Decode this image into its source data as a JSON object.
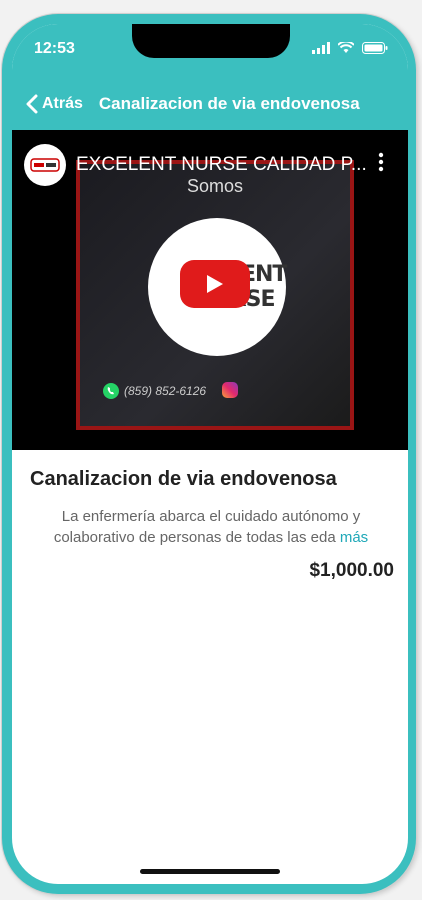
{
  "status_bar": {
    "time": "12:53"
  },
  "nav": {
    "back_label": "Atrás",
    "title": "Canalizacion de via endovenosa"
  },
  "video": {
    "channel_title": "EXCELENT NURSE CALIDAD P...",
    "subtitle": "Somos",
    "logo_line1": "XCELENT",
    "logo_line2": "NURSE",
    "phone": "(859) 852-6126"
  },
  "product": {
    "title": "Canalizacion de via endovenosa",
    "description": "La enfermería abarca el cuidado autónomo y colaborativo de personas de todas las eda",
    "more_label": "más",
    "price": "$1,000.00"
  },
  "colors": {
    "accent": "#3bbfbf",
    "link": "#1fa8b8",
    "play": "#e01b1b"
  }
}
